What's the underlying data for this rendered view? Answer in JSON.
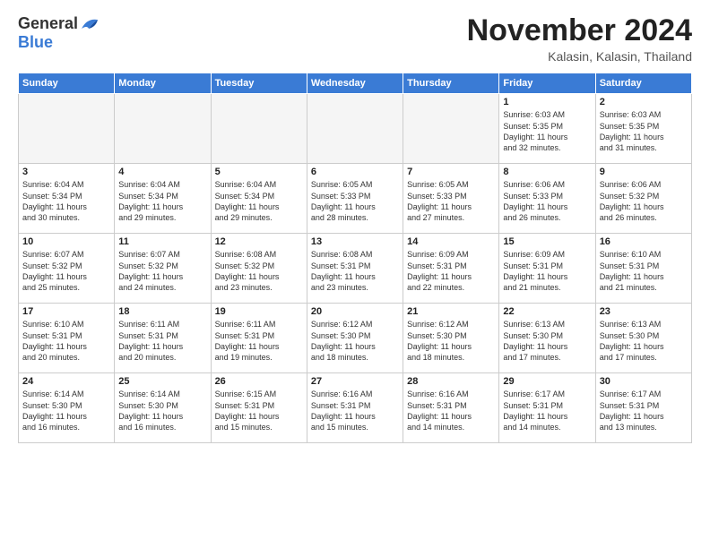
{
  "logo": {
    "general": "General",
    "blue": "Blue"
  },
  "title": "November 2024",
  "subtitle": "Kalasin, Kalasin, Thailand",
  "weekdays": [
    "Sunday",
    "Monday",
    "Tuesday",
    "Wednesday",
    "Thursday",
    "Friday",
    "Saturday"
  ],
  "weeks": [
    [
      {
        "day": "",
        "info": ""
      },
      {
        "day": "",
        "info": ""
      },
      {
        "day": "",
        "info": ""
      },
      {
        "day": "",
        "info": ""
      },
      {
        "day": "",
        "info": ""
      },
      {
        "day": "1",
        "info": "Sunrise: 6:03 AM\nSunset: 5:35 PM\nDaylight: 11 hours\nand 32 minutes."
      },
      {
        "day": "2",
        "info": "Sunrise: 6:03 AM\nSunset: 5:35 PM\nDaylight: 11 hours\nand 31 minutes."
      }
    ],
    [
      {
        "day": "3",
        "info": "Sunrise: 6:04 AM\nSunset: 5:34 PM\nDaylight: 11 hours\nand 30 minutes."
      },
      {
        "day": "4",
        "info": "Sunrise: 6:04 AM\nSunset: 5:34 PM\nDaylight: 11 hours\nand 29 minutes."
      },
      {
        "day": "5",
        "info": "Sunrise: 6:04 AM\nSunset: 5:34 PM\nDaylight: 11 hours\nand 29 minutes."
      },
      {
        "day": "6",
        "info": "Sunrise: 6:05 AM\nSunset: 5:33 PM\nDaylight: 11 hours\nand 28 minutes."
      },
      {
        "day": "7",
        "info": "Sunrise: 6:05 AM\nSunset: 5:33 PM\nDaylight: 11 hours\nand 27 minutes."
      },
      {
        "day": "8",
        "info": "Sunrise: 6:06 AM\nSunset: 5:33 PM\nDaylight: 11 hours\nand 26 minutes."
      },
      {
        "day": "9",
        "info": "Sunrise: 6:06 AM\nSunset: 5:32 PM\nDaylight: 11 hours\nand 26 minutes."
      }
    ],
    [
      {
        "day": "10",
        "info": "Sunrise: 6:07 AM\nSunset: 5:32 PM\nDaylight: 11 hours\nand 25 minutes."
      },
      {
        "day": "11",
        "info": "Sunrise: 6:07 AM\nSunset: 5:32 PM\nDaylight: 11 hours\nand 24 minutes."
      },
      {
        "day": "12",
        "info": "Sunrise: 6:08 AM\nSunset: 5:32 PM\nDaylight: 11 hours\nand 23 minutes."
      },
      {
        "day": "13",
        "info": "Sunrise: 6:08 AM\nSunset: 5:31 PM\nDaylight: 11 hours\nand 23 minutes."
      },
      {
        "day": "14",
        "info": "Sunrise: 6:09 AM\nSunset: 5:31 PM\nDaylight: 11 hours\nand 22 minutes."
      },
      {
        "day": "15",
        "info": "Sunrise: 6:09 AM\nSunset: 5:31 PM\nDaylight: 11 hours\nand 21 minutes."
      },
      {
        "day": "16",
        "info": "Sunrise: 6:10 AM\nSunset: 5:31 PM\nDaylight: 11 hours\nand 21 minutes."
      }
    ],
    [
      {
        "day": "17",
        "info": "Sunrise: 6:10 AM\nSunset: 5:31 PM\nDaylight: 11 hours\nand 20 minutes."
      },
      {
        "day": "18",
        "info": "Sunrise: 6:11 AM\nSunset: 5:31 PM\nDaylight: 11 hours\nand 20 minutes."
      },
      {
        "day": "19",
        "info": "Sunrise: 6:11 AM\nSunset: 5:31 PM\nDaylight: 11 hours\nand 19 minutes."
      },
      {
        "day": "20",
        "info": "Sunrise: 6:12 AM\nSunset: 5:30 PM\nDaylight: 11 hours\nand 18 minutes."
      },
      {
        "day": "21",
        "info": "Sunrise: 6:12 AM\nSunset: 5:30 PM\nDaylight: 11 hours\nand 18 minutes."
      },
      {
        "day": "22",
        "info": "Sunrise: 6:13 AM\nSunset: 5:30 PM\nDaylight: 11 hours\nand 17 minutes."
      },
      {
        "day": "23",
        "info": "Sunrise: 6:13 AM\nSunset: 5:30 PM\nDaylight: 11 hours\nand 17 minutes."
      }
    ],
    [
      {
        "day": "24",
        "info": "Sunrise: 6:14 AM\nSunset: 5:30 PM\nDaylight: 11 hours\nand 16 minutes."
      },
      {
        "day": "25",
        "info": "Sunrise: 6:14 AM\nSunset: 5:30 PM\nDaylight: 11 hours\nand 16 minutes."
      },
      {
        "day": "26",
        "info": "Sunrise: 6:15 AM\nSunset: 5:31 PM\nDaylight: 11 hours\nand 15 minutes."
      },
      {
        "day": "27",
        "info": "Sunrise: 6:16 AM\nSunset: 5:31 PM\nDaylight: 11 hours\nand 15 minutes."
      },
      {
        "day": "28",
        "info": "Sunrise: 6:16 AM\nSunset: 5:31 PM\nDaylight: 11 hours\nand 14 minutes."
      },
      {
        "day": "29",
        "info": "Sunrise: 6:17 AM\nSunset: 5:31 PM\nDaylight: 11 hours\nand 14 minutes."
      },
      {
        "day": "30",
        "info": "Sunrise: 6:17 AM\nSunset: 5:31 PM\nDaylight: 11 hours\nand 13 minutes."
      }
    ]
  ]
}
